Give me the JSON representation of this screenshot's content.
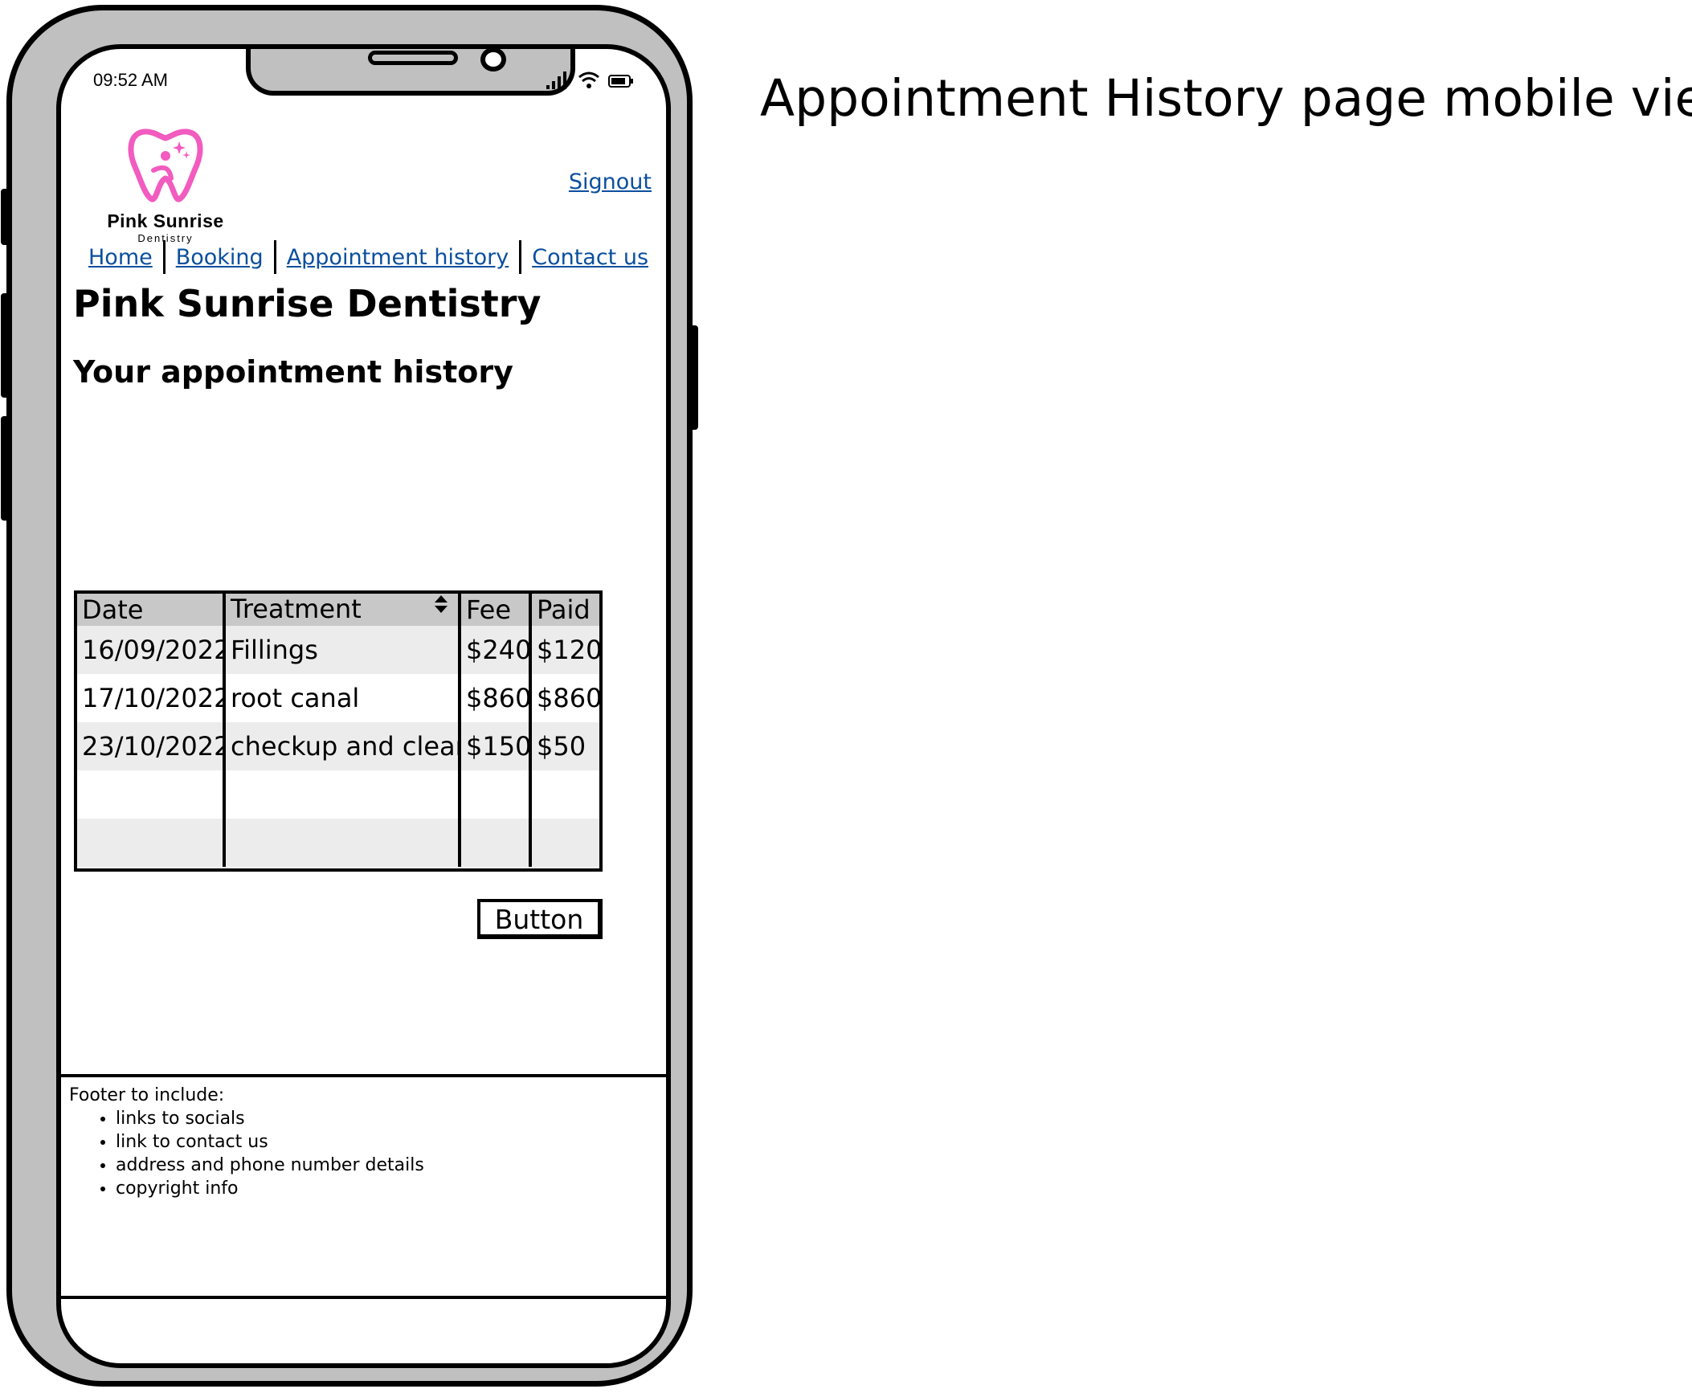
{
  "page_caption": "Appointment History page mobile view",
  "status_bar": {
    "time": "09:52 AM"
  },
  "logo": {
    "name": "Pink Sunrise",
    "sub": "Dentistry"
  },
  "header": {
    "signout_label": "Signout"
  },
  "nav": {
    "items": [
      {
        "label": "Home"
      },
      {
        "label": "Booking"
      },
      {
        "label": "Appointment history"
      },
      {
        "label": "Contact us"
      }
    ]
  },
  "main": {
    "title": "Pink Sunrise Dentistry",
    "subtitle": "Your appointment history",
    "button_label": "Button"
  },
  "table": {
    "headers": [
      "Date",
      "Treatment",
      "Fee",
      "Paid"
    ],
    "rows": [
      [
        "16/09/2022",
        "Fillings",
        "$240",
        "$120"
      ],
      [
        "17/10/2022",
        "root canal",
        "$860",
        "$860"
      ],
      [
        "23/10/2022",
        "checkup and clean",
        "$150",
        "$50"
      ],
      [
        "",
        "",
        "",
        ""
      ],
      [
        "",
        "",
        "",
        ""
      ]
    ]
  },
  "footer": {
    "heading": "Footer to include:",
    "items": [
      "links to socials",
      "link to contact us",
      "address and phone number details",
      "copyright info"
    ]
  },
  "colors": {
    "link": "#0b4f9e",
    "logo_pink": "#f25bbf",
    "frame_gray": "#c0c0c0",
    "table_header": "#c8c8c8",
    "table_stripe": "#ececec"
  }
}
